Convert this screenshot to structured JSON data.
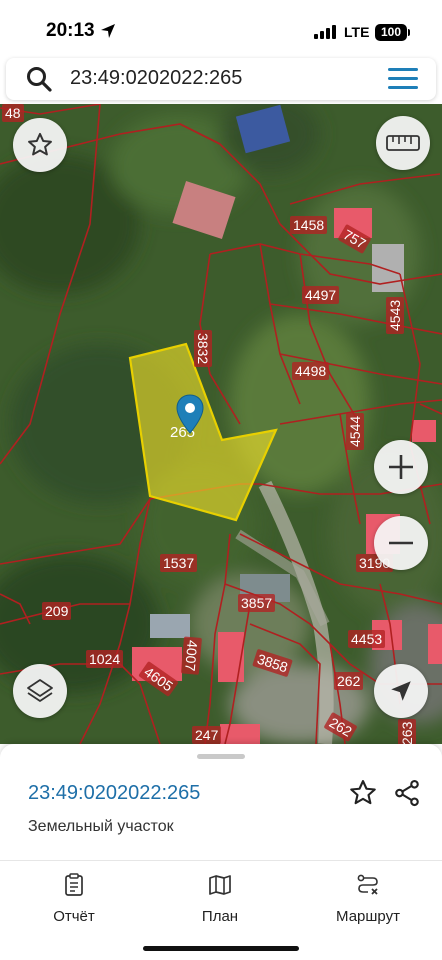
{
  "status_bar": {
    "time": "20:13",
    "network": "LTE",
    "battery": "100"
  },
  "search": {
    "query": "23:49:0202022:265"
  },
  "map": {
    "selected_label": "265",
    "parcel_labels": [
      "48",
      "1458",
      "757",
      "4497",
      "4543",
      "3832",
      "4498",
      "4544",
      "1537",
      "3190",
      "209",
      "3857",
      "4453",
      "1024",
      "4007",
      "3858",
      "4605",
      "262",
      "262",
      "247",
      "263"
    ]
  },
  "info": {
    "cadastral_number": "23:49:0202022:265",
    "object_type": "Земельный участок"
  },
  "tabs": [
    {
      "label": "Отчёт",
      "icon": "report-icon"
    },
    {
      "label": "План",
      "icon": "map-plan-icon"
    },
    {
      "label": "Маршрут",
      "icon": "route-icon"
    }
  ],
  "colors": {
    "accent": "#1e7fb8",
    "parcel_outline": "#b02020",
    "parcel_fill": "#e85a6a",
    "selected_fill": "#f0e12a"
  }
}
